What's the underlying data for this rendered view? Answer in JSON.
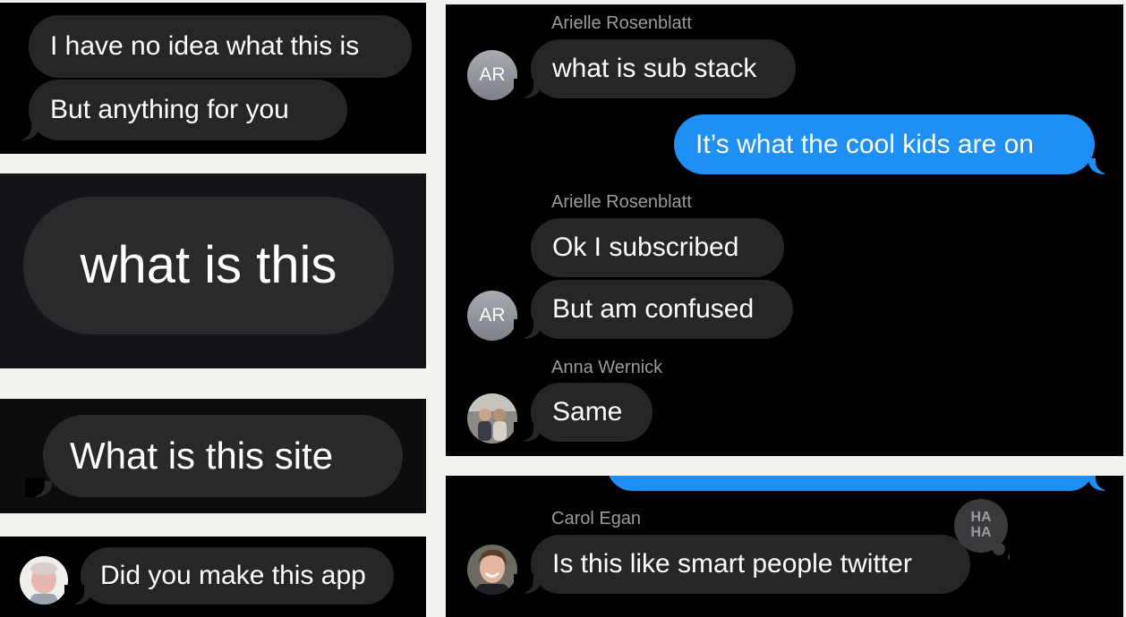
{
  "panel1": {
    "messages": [
      "I have no idea what this is",
      "But anything for you"
    ]
  },
  "panel2": {
    "message": "what is this"
  },
  "panel3": {
    "message": "What is this site"
  },
  "panel4": {
    "message": "Did you make this app"
  },
  "panel5": {
    "sender1": "Arielle Rosenblatt",
    "msg1": "what is sub stack",
    "avatar_initials": "AR",
    "reply": "It’s what the cool kids are on",
    "sender2": "Arielle Rosenblatt",
    "msg2": "Ok I subscribed",
    "msg3": "But am confused",
    "sender3": "Anna Wernick",
    "msg4": "Same"
  },
  "panel6": {
    "sender": "Carol Egan",
    "message": "Is this like smart people twitter",
    "reaction": "HA HA",
    "reaction_icon": "haha-tapback-icon"
  },
  "colors": {
    "incoming": "#262628",
    "outgoing": "#1d8ff5",
    "background": "#000000"
  }
}
